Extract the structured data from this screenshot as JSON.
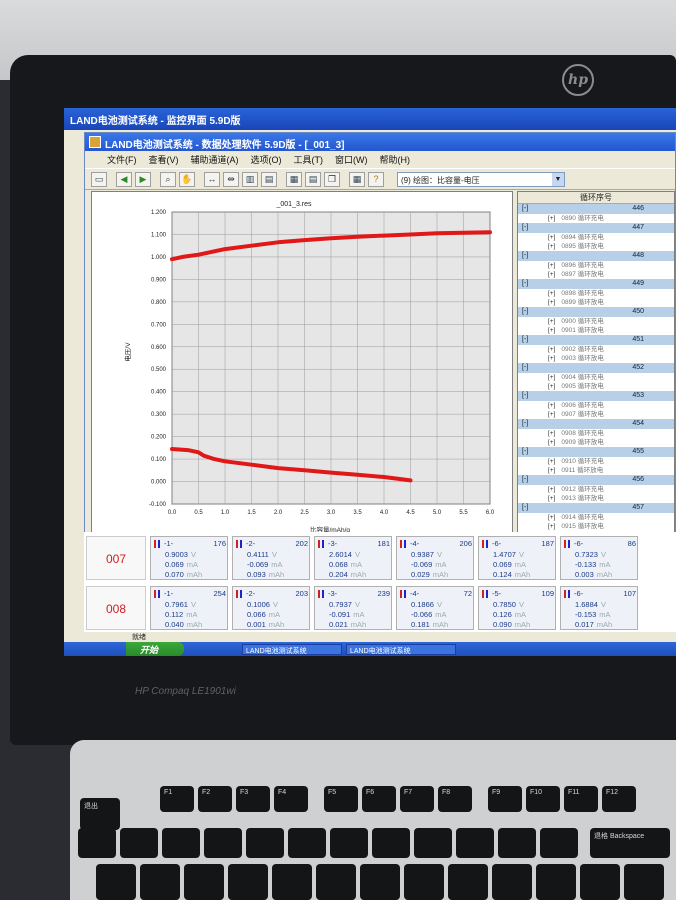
{
  "monitor": {
    "brand": "HP Compaq LE1901wi",
    "logo": "hp"
  },
  "outer_window": {
    "title": "LAND电池测试系统 - 监控界面 5.9D版"
  },
  "inner_window": {
    "title": "LAND电池测试系统 - 数据处理软件 5.9D版 - [_001_3]"
  },
  "menu": [
    "文件(F)",
    "查看(V)",
    "辅助通道(A)",
    "选项(O)",
    "工具(T)",
    "窗口(W)",
    "帮助(H)"
  ],
  "toolbar": {
    "plot_select": "(9) 绘图：比容量-电压"
  },
  "chart_data": {
    "type": "line",
    "title": "_001_3.res",
    "xlabel": "比容量/mAh/g",
    "ylabel": "电压/V",
    "xlim": [
      0,
      6
    ],
    "ylim": [
      -0.1,
      1.2
    ],
    "xticks": [
      "0.0",
      "0.5",
      "1.0",
      "1.5",
      "2.0",
      "2.5",
      "3.0",
      "3.5",
      "4.0",
      "4.5",
      "5.0",
      "5.5",
      "6.0"
    ],
    "yticks": [
      "1.200",
      "1.100",
      "1.000",
      "0.900",
      "0.800",
      "0.700",
      "0.600",
      "0.500",
      "0.400",
      "0.300",
      "0.200",
      "0.100",
      "0.000",
      "-0.100"
    ],
    "grid": true,
    "series": [
      {
        "color": "#e01818",
        "x": [
          0,
          0.2,
          0.5,
          0.8,
          1.0,
          1.5,
          2.0,
          2.5,
          3.0,
          3.5,
          4.0,
          4.5,
          5.0,
          5.5,
          6.0
        ],
        "y": [
          0.99,
          1.0,
          1.01,
          1.025,
          1.035,
          1.05,
          1.065,
          1.075,
          1.083,
          1.09,
          1.095,
          1.1,
          1.105,
          1.108,
          1.11
        ]
      },
      {
        "color": "#e01818",
        "x": [
          0,
          0.3,
          0.5,
          0.6,
          0.8,
          1.0,
          1.5,
          2.0,
          2.5,
          3.0,
          3.5,
          4.0,
          4.5
        ],
        "y": [
          0.145,
          0.14,
          0.13,
          0.115,
          0.1,
          0.09,
          0.075,
          0.06,
          0.05,
          0.04,
          0.03,
          0.02,
          0.005
        ]
      }
    ]
  },
  "status_left": "就绪",
  "cycle_list": {
    "header": "循环序号",
    "groups": [
      {
        "sign": "[-]",
        "num": "446",
        "subs": [
          [
            "[+]",
            "0890 循环充电"
          ]
        ]
      },
      {
        "sign": "[-]",
        "num": "447",
        "subs": [
          [
            "[+]",
            "0894 循环充电"
          ],
          [
            "[+]",
            "0895 循环放电"
          ]
        ]
      },
      {
        "sign": "[-]",
        "num": "448",
        "subs": [
          [
            "[+]",
            "0896 循环充电"
          ],
          [
            "[+]",
            "0897 循环放电"
          ]
        ]
      },
      {
        "sign": "[-]",
        "num": "449",
        "subs": [
          [
            "[+]",
            "0898 循环充电"
          ],
          [
            "[+]",
            "0899 循环放电"
          ]
        ]
      },
      {
        "sign": "[-]",
        "num": "450",
        "subs": [
          [
            "[+]",
            "0900 循环充电"
          ],
          [
            "[+]",
            "0901 循环放电"
          ]
        ]
      },
      {
        "sign": "[-]",
        "num": "451",
        "subs": [
          [
            "[+]",
            "0902 循环充电"
          ],
          [
            "[+]",
            "0903 循环放电"
          ]
        ]
      },
      {
        "sign": "[-]",
        "num": "452",
        "subs": [
          [
            "[+]",
            "0904 循环充电"
          ],
          [
            "[+]",
            "0905 循环放电"
          ]
        ]
      },
      {
        "sign": "[-]",
        "num": "453",
        "subs": [
          [
            "[+]",
            "0906 循环充电"
          ],
          [
            "[+]",
            "0907 循环放电"
          ]
        ]
      },
      {
        "sign": "[-]",
        "num": "454",
        "subs": [
          [
            "[+]",
            "0908 循环充电"
          ],
          [
            "[+]",
            "0909 循环放电"
          ]
        ]
      },
      {
        "sign": "[-]",
        "num": "455",
        "subs": [
          [
            "[+]",
            "0910 循环充电"
          ],
          [
            "[+]",
            "0911 循环放电"
          ]
        ]
      },
      {
        "sign": "[-]",
        "num": "456",
        "subs": [
          [
            "[+]",
            "0912 循环充电"
          ],
          [
            "[+]",
            "0913 循环放电"
          ]
        ]
      },
      {
        "sign": "[-]",
        "num": "457",
        "subs": [
          [
            "[+]",
            "0914 循环充电"
          ],
          [
            "[+]",
            "0915 循环放电"
          ]
        ]
      }
    ]
  },
  "channels": [
    {
      "row": "007",
      "cells": [
        {
          "id": "-1-",
          "n": "176",
          "v": "0.9003",
          "u1": "V",
          "a": "0.069",
          "u2": "mA",
          "c": "0.070",
          "u3": "mAh"
        },
        {
          "id": "-2-",
          "n": "202",
          "v": "0.4111",
          "u1": "V",
          "a": "-0.069",
          "u2": "mA",
          "c": "0.093",
          "u3": "mAh"
        },
        {
          "id": "-3-",
          "n": "181",
          "v": "2.6014",
          "u1": "V",
          "a": "0.068",
          "u2": "mA",
          "c": "0.204",
          "u3": "mAh"
        },
        {
          "id": "-4-",
          "n": "206",
          "v": "0.9387",
          "u1": "V",
          "a": "-0.069",
          "u2": "mA",
          "c": "0.029",
          "u3": "mAh"
        },
        {
          "id": "-6-",
          "n": "187",
          "v": "1.4707",
          "u1": "V",
          "a": "0.069",
          "u2": "mA",
          "c": "0.124",
          "u3": "mAh"
        },
        {
          "id": "-6-",
          "n": "86",
          "v": "0.7323",
          "u1": "V",
          "a": "-0.133",
          "u2": "mA",
          "c": "0.003",
          "u3": "mAh"
        }
      ]
    },
    {
      "row": "008",
      "cells": [
        {
          "id": "-1-",
          "n": "254",
          "v": "0.7961",
          "u1": "V",
          "a": "0.112",
          "u2": "mA",
          "c": "0.040",
          "u3": "mAh"
        },
        {
          "id": "-2-",
          "n": "203",
          "v": "0.1006",
          "u1": "V",
          "a": "0.066",
          "u2": "mA",
          "c": "0.001",
          "u3": "mAh"
        },
        {
          "id": "-3-",
          "n": "239",
          "v": "0.7937",
          "u1": "V",
          "a": "-0.091",
          "u2": "mA",
          "c": "0.021",
          "u3": "mAh"
        },
        {
          "id": "-4-",
          "n": "72",
          "v": "0.1866",
          "u1": "V",
          "a": "-0.066",
          "u2": "mA",
          "c": "0.181",
          "u3": "mAh"
        },
        {
          "id": "-5-",
          "n": "109",
          "v": "0.7850",
          "u1": "V",
          "a": "0.126",
          "u2": "mA",
          "c": "0.090",
          "u3": "mAh"
        },
        {
          "id": "-6-",
          "n": "107",
          "v": "1.6884",
          "u1": "V",
          "a": "-0.153",
          "u2": "mA",
          "c": "0.017",
          "u3": "mAh"
        }
      ]
    }
  ],
  "status_bottom": "就绪",
  "taskbar": {
    "start": "开始",
    "tasks": [
      "LAND电池测试系统",
      "LAND电池测试系统"
    ]
  },
  "keyboard": {
    "row1": [
      "退出",
      "F1",
      "F2",
      "F3",
      "F4",
      "F5",
      "F6",
      "F7",
      "F8",
      "F9",
      "F10",
      "F11",
      "F12"
    ],
    "backspace": "退格 Backspace"
  }
}
